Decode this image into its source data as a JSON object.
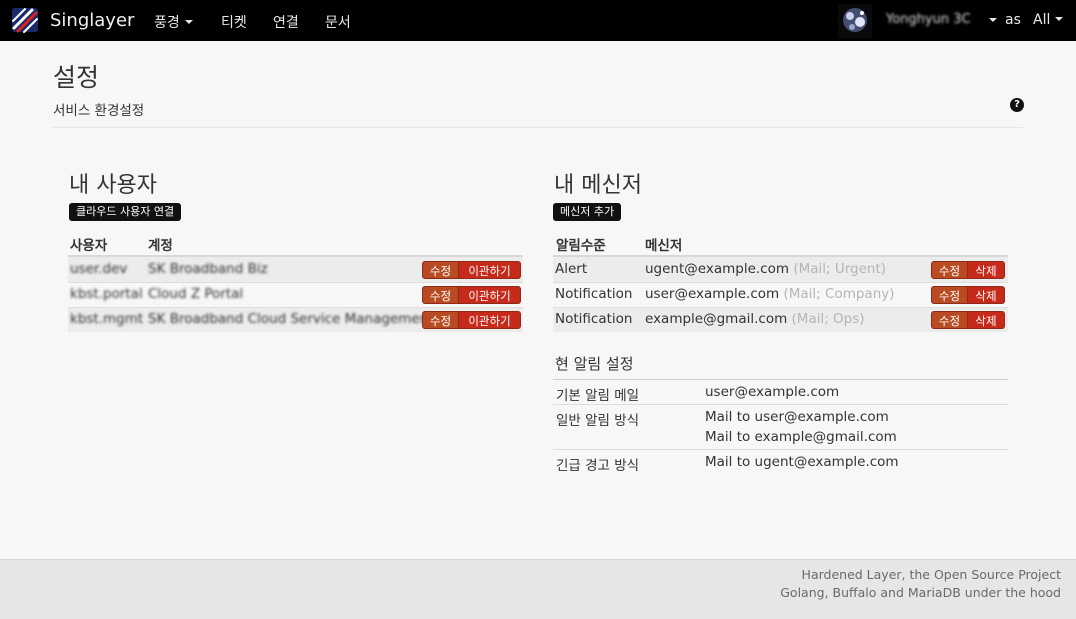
{
  "navbar": {
    "brand": "Singlayer",
    "menu": [
      {
        "label": "풍경",
        "has_dropdown": true
      },
      {
        "label": "티켓",
        "has_dropdown": false
      },
      {
        "label": "연결",
        "has_dropdown": false
      },
      {
        "label": "문서",
        "has_dropdown": false
      }
    ],
    "user_name": "Yonghyun 3C",
    "as_label": "as",
    "scope": "All"
  },
  "page": {
    "title": "설정",
    "subtitle": "서비스 환경설정"
  },
  "users": {
    "heading": "내 사용자",
    "link_button": "클라우드 사용자 연결",
    "columns": [
      "사용자",
      "계정"
    ],
    "rows": [
      {
        "user": "user.dev",
        "account": "SK Broadband Biz",
        "edit": "수정",
        "action": "이관하기"
      },
      {
        "user": "kbst.portal",
        "account": "Cloud Z Portal",
        "edit": "수정",
        "action": "이관하기"
      },
      {
        "user": "kbst.mgmt",
        "account": "SK Broadband Cloud Service Management",
        "edit": "수정",
        "action": "이관하기"
      }
    ]
  },
  "messengers": {
    "heading": "내 메신저",
    "add_button": "메신저 추가",
    "columns": [
      "알림수준",
      "메신저"
    ],
    "rows": [
      {
        "level": "Alert",
        "address": "ugent@example.com",
        "meta": "(Mail; Urgent)",
        "edit": "수정",
        "delete": "삭제"
      },
      {
        "level": "Notification",
        "address": "user@example.com",
        "meta": "(Mail; Company)",
        "edit": "수정",
        "delete": "삭제"
      },
      {
        "level": "Notification",
        "address": "example@gmail.com",
        "meta": "(Mail; Ops)",
        "edit": "수정",
        "delete": "삭제"
      }
    ]
  },
  "current_settings": {
    "heading": "현 알림 설정",
    "rows": [
      {
        "label": "기본 알림 메일",
        "values": [
          "user@example.com"
        ]
      },
      {
        "label": "일반 알림 방식",
        "values": [
          "Mail to user@example.com",
          "Mail to example@gmail.com"
        ]
      },
      {
        "label": "긴급 경고 방식",
        "values": [
          "Mail to ugent@example.com"
        ]
      }
    ]
  },
  "footer": {
    "line1": "Hardened Layer, the Open Source Project",
    "line2": "Golang, Buffalo and MariaDB under the hood"
  },
  "colors": {
    "navbar_bg": "#000000",
    "edit_button": "#b84b22",
    "danger_button": "#c62a1a",
    "page_bg": "#f7f7f7"
  }
}
